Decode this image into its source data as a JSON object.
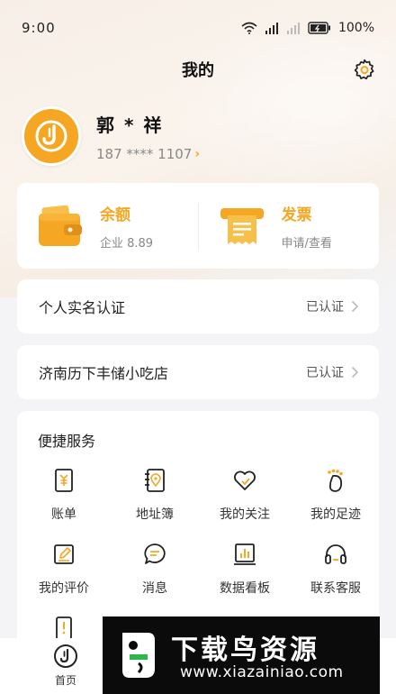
{
  "status_bar": {
    "time": "9:00",
    "battery": "100%",
    "icons": [
      "wifi-icon",
      "signal-icon",
      "signal-icon",
      "battery-icon"
    ]
  },
  "header": {
    "title": "我的",
    "settings_icon": "gear-icon"
  },
  "profile": {
    "name": "郭 * 祥",
    "phone": "187 **** 1107",
    "avatar_icon": "j-logo-icon"
  },
  "wallet": {
    "balance_title": "余额",
    "balance_sub": "企业 8.89",
    "invoice_title": "发票",
    "invoice_sub": "申请/查看"
  },
  "rows": {
    "realname_label": "个人实名认证",
    "realname_status": "已认证",
    "shop_label": "济南历下丰储小吃店",
    "shop_status": "已认证"
  },
  "services": {
    "title": "便捷服务",
    "items": [
      {
        "label": "账单",
        "icon": "bill-icon"
      },
      {
        "label": "地址簿",
        "icon": "address-book-icon"
      },
      {
        "label": "我的关注",
        "icon": "heart-icon"
      },
      {
        "label": "我的足迹",
        "icon": "footprint-icon"
      },
      {
        "label": "我的评价",
        "icon": "review-icon"
      },
      {
        "label": "消息",
        "icon": "message-icon"
      },
      {
        "label": "数据看板",
        "icon": "data-board-icon"
      },
      {
        "label": "联系客服",
        "icon": "headset-icon"
      },
      {
        "label": "",
        "icon": "alert-icon"
      }
    ]
  },
  "tabbar": {
    "home_label": "首页"
  },
  "watermark": {
    "text": "下载鸟资源",
    "url": "www.xiazainiao.com"
  },
  "colors": {
    "accent": "#f5a623",
    "background": "#f4f4f6"
  }
}
